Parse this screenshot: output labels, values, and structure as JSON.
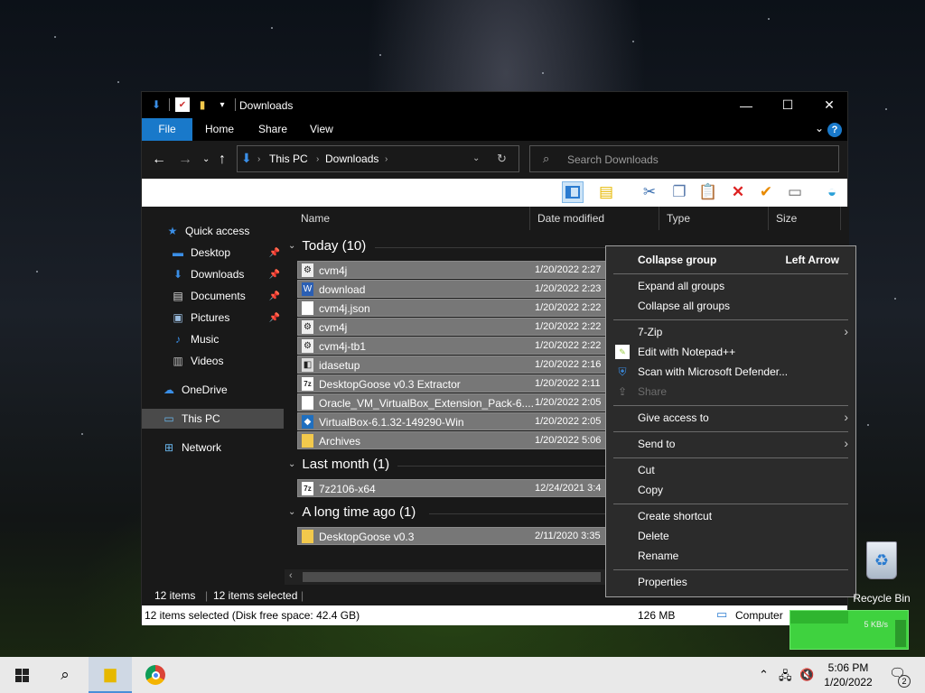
{
  "window": {
    "title": "Downloads",
    "controls": {
      "minimize": "—",
      "maximize": "☐",
      "close": "✕"
    }
  },
  "ribbon": {
    "tabs": [
      "File",
      "Home",
      "Share",
      "View"
    ],
    "help": "?"
  },
  "address": {
    "segments": [
      "This PC",
      "Downloads"
    ],
    "search_placeholder": "Search Downloads"
  },
  "nav_pane": {
    "items": [
      {
        "label": "Quick access",
        "icon": "star-icon",
        "pinned": false
      },
      {
        "label": "Desktop",
        "icon": "desktop-icon",
        "pinned": true
      },
      {
        "label": "Downloads",
        "icon": "download-icon",
        "pinned": true
      },
      {
        "label": "Documents",
        "icon": "documents-icon",
        "pinned": true
      },
      {
        "label": "Pictures",
        "icon": "pictures-icon",
        "pinned": true
      },
      {
        "label": "Music",
        "icon": "music-icon",
        "pinned": false
      },
      {
        "label": "Videos",
        "icon": "videos-icon",
        "pinned": false
      },
      {
        "label": "OneDrive",
        "icon": "cloud-icon",
        "pinned": false
      },
      {
        "label": "This PC",
        "icon": "computer-icon",
        "pinned": false,
        "selected": true
      },
      {
        "label": "Network",
        "icon": "network-icon",
        "pinned": false
      }
    ]
  },
  "columns": [
    "Name",
    "Date modified",
    "Type",
    "Size"
  ],
  "groups": [
    {
      "title": "Today (10)",
      "files": [
        {
          "name": "cvm4j",
          "date": "1/20/2022 2:27",
          "icon": "exe-icon"
        },
        {
          "name": "download",
          "date": "1/20/2022 2:23",
          "icon": "doc-icon"
        },
        {
          "name": "cvm4j.json",
          "date": "1/20/2022 2:22",
          "icon": "file-icon"
        },
        {
          "name": "cvm4j",
          "date": "1/20/2022 2:22",
          "icon": "gear-file-icon"
        },
        {
          "name": "cvm4j-tb1",
          "date": "1/20/2022 2:22",
          "icon": "exe-icon"
        },
        {
          "name": "idasetup",
          "date": "1/20/2022 2:16",
          "icon": "setup-icon"
        },
        {
          "name": "DesktopGoose v0.3 Extractor",
          "date": "1/20/2022 2:11",
          "icon": "7zip-icon"
        },
        {
          "name": "Oracle_VM_VirtualBox_Extension_Pack-6....",
          "date": "1/20/2022 2:05",
          "icon": "file-icon"
        },
        {
          "name": "VirtualBox-6.1.32-149290-Win",
          "date": "1/20/2022 2:05",
          "icon": "virtualbox-icon"
        },
        {
          "name": "Archives",
          "date": "1/20/2022 5:06",
          "icon": "folder-icon"
        }
      ]
    },
    {
      "title": "Last month (1)",
      "files": [
        {
          "name": "7z2106-x64",
          "date": "12/24/2021 3:4",
          "icon": "7zip-icon"
        }
      ]
    },
    {
      "title": "A long time ago (1)",
      "files": [
        {
          "name": "DesktopGoose v0.3",
          "date": "2/11/2020 3:35",
          "icon": "folder-icon"
        }
      ]
    }
  ],
  "status": {
    "items": "12 items",
    "selected": "12 items selected",
    "details": "12 items selected (Disk free space: 42.4 GB)",
    "size": "126 MB",
    "location": "Computer"
  },
  "context_menu": {
    "collapse_group": "Collapse group",
    "collapse_group_shortcut": "Left Arrow",
    "expand_all": "Expand all groups",
    "collapse_all": "Collapse all groups",
    "seven_zip": "7-Zip",
    "edit_notepad": "Edit with Notepad++",
    "scan_defender": "Scan with Microsoft Defender...",
    "share": "Share",
    "give_access": "Give access to",
    "send_to": "Send to",
    "cut": "Cut",
    "copy": "Copy",
    "create_shortcut": "Create shortcut",
    "delete": "Delete",
    "rename": "Rename",
    "properties": "Properties"
  },
  "desktop": {
    "recycle_bin": "Recycle Bin",
    "net_speed": "5 KB/s"
  },
  "taskbar": {
    "time": "5:06 PM",
    "date": "1/20/2022",
    "notifications": "2"
  },
  "colors": {
    "accent": "#1979ca",
    "selection": "#777777",
    "menu_bg": "#2b2b2b"
  }
}
